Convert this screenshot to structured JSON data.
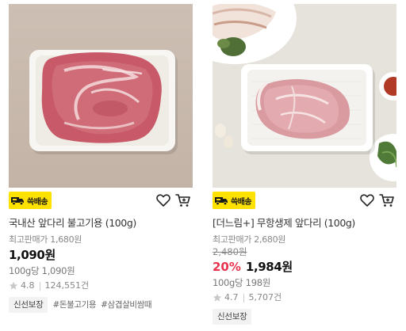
{
  "products": [
    {
      "badge": "쓱배송",
      "title": "국내산 앞다리 불고기용 (100g)",
      "max_price_label": "최고판매가 1,680원",
      "original_price": "",
      "discount": "",
      "price": "1,090원",
      "unit_price": "100g당 1,090원",
      "rating": "4.8",
      "reviews": "124,551건",
      "tags": [
        "신선보장"
      ],
      "hashtags": [
        "#돈불고기용",
        "#삼겹살비쌈때"
      ]
    },
    {
      "badge": "쓱배송",
      "title": "[더느림+] 무항생제 앞다리 (100g)",
      "max_price_label": "최고판매가 2,680원",
      "original_price": "2,480원",
      "discount": "20%",
      "price": "1,984원",
      "unit_price": "100g당 198원",
      "rating": "4.7",
      "reviews": "5,707건",
      "tags": [
        "신선보장"
      ],
      "hashtags": []
    }
  ],
  "colors": {
    "badge_bg": "#ffe100",
    "discount": "#e8344e",
    "star": "#c8c8c8"
  },
  "icons": [
    "truck-icon",
    "heart-icon",
    "cart-icon",
    "star-icon"
  ]
}
